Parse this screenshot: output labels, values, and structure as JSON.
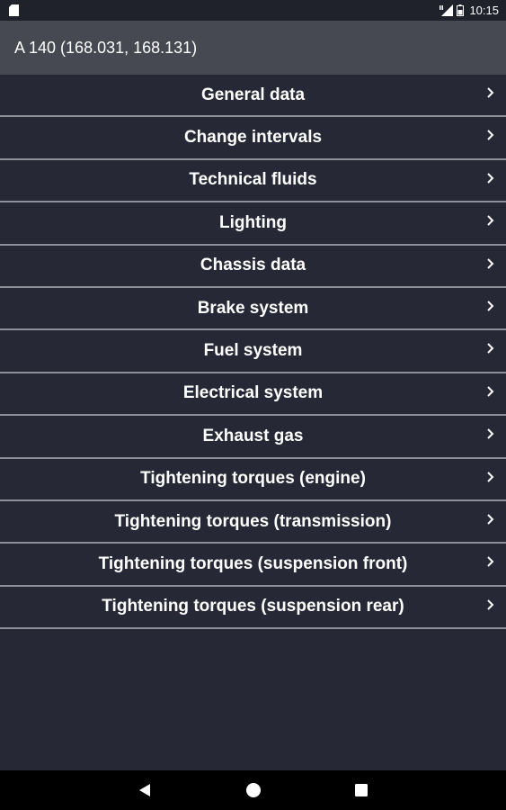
{
  "status_bar": {
    "time": "10:15",
    "icons": [
      "sd-card-icon",
      "mobile-data-icon",
      "battery-icon"
    ]
  },
  "app_bar": {
    "title": "A 140 (168.031, 168.131)"
  },
  "menu": {
    "items": [
      {
        "label": "General data",
        "icon": "chevron-right-icon"
      },
      {
        "label": "Change intervals",
        "icon": "chevron-right-icon"
      },
      {
        "label": "Technical fluids",
        "icon": "chevron-right-icon"
      },
      {
        "label": "Lighting",
        "icon": "chevron-right-icon"
      },
      {
        "label": "Chassis data",
        "icon": "chevron-right-icon"
      },
      {
        "label": "Brake system",
        "icon": "chevron-right-icon"
      },
      {
        "label": "Fuel system",
        "icon": "chevron-right-icon"
      },
      {
        "label": "Electrical system",
        "icon": "chevron-right-icon"
      },
      {
        "label": "Exhaust gas",
        "icon": "chevron-right-icon"
      },
      {
        "label": "Tightening torques (engine)",
        "icon": "chevron-right-icon"
      },
      {
        "label": "Tightening torques (transmission)",
        "icon": "chevron-right-icon"
      },
      {
        "label": "Tightening torques (suspension front)",
        "icon": "chevron-right-icon"
      },
      {
        "label": "Tightening torques (suspension rear)",
        "icon": "chevron-right-icon"
      }
    ]
  },
  "nav_bar": {
    "buttons": [
      "back-icon",
      "home-icon",
      "recents-icon"
    ]
  },
  "colors": {
    "background": "#262835",
    "app_bar": "#464852",
    "divider": "#8e9099",
    "text": "#ffffff"
  }
}
